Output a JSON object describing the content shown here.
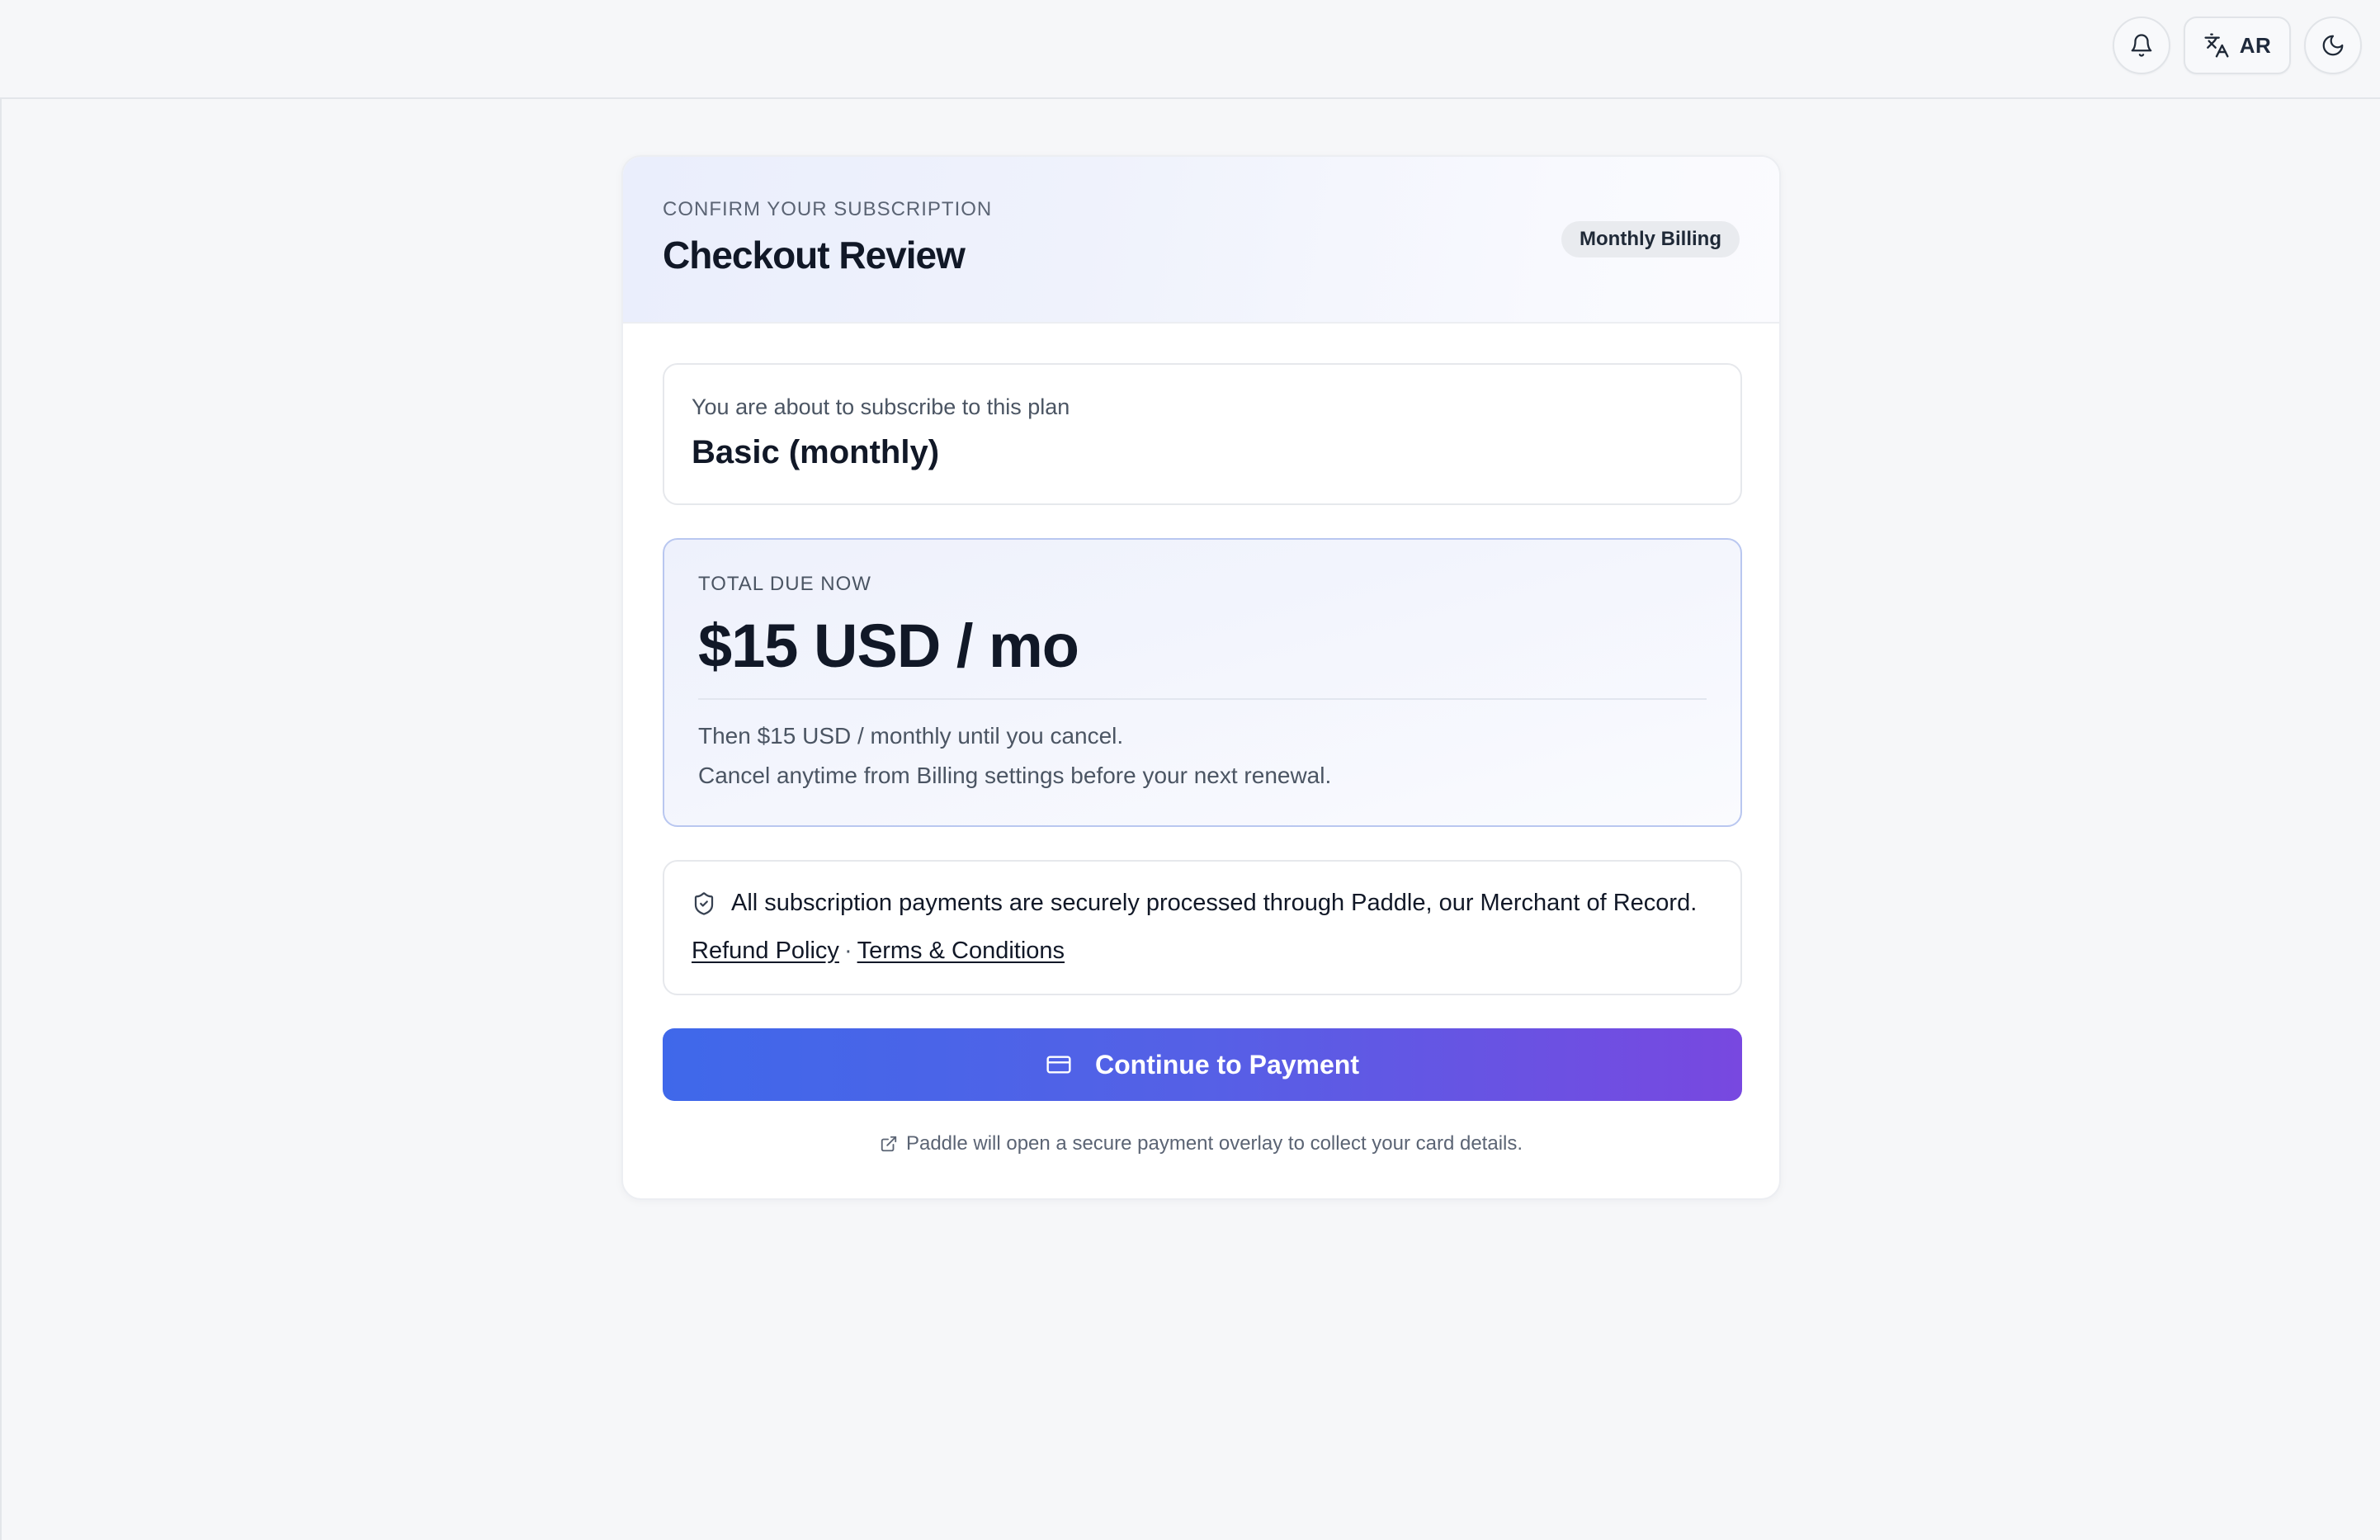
{
  "topbar": {
    "notifications_icon": "bell-icon",
    "language": {
      "icon": "translate-icon",
      "label": "AR"
    },
    "theme_icon": "moon-icon"
  },
  "checkout": {
    "eyebrow": "CONFIRM YOUR SUBSCRIPTION",
    "title": "Checkout Review",
    "billing_badge": "Monthly Billing",
    "plan": {
      "label": "You are about to subscribe to this plan",
      "name": "Basic (monthly)"
    },
    "total": {
      "label": "TOTAL DUE NOW",
      "amount": "$15 USD / mo",
      "note_recurring": "Then $15 USD / monthly until you cancel.",
      "note_cancel": "Cancel anytime from Billing settings before your next renewal."
    },
    "secure": {
      "icon": "shield-check-icon",
      "text": "All subscription payments are securely processed through Paddle, our Merchant of Record.",
      "refund_link": "Refund Policy",
      "separator": "·",
      "terms_link": "Terms & Conditions"
    },
    "pay_button": {
      "icon": "credit-card-icon",
      "label": "Continue to Payment"
    },
    "footnote": {
      "icon": "external-link-icon",
      "text": "Paddle will open a secure payment overlay to collect your card details."
    }
  },
  "colors": {
    "accent_start": "#3f68ea",
    "accent_end": "#7848e0",
    "page_background": "#f6f7f9",
    "total_border": "#b9c7f0"
  }
}
